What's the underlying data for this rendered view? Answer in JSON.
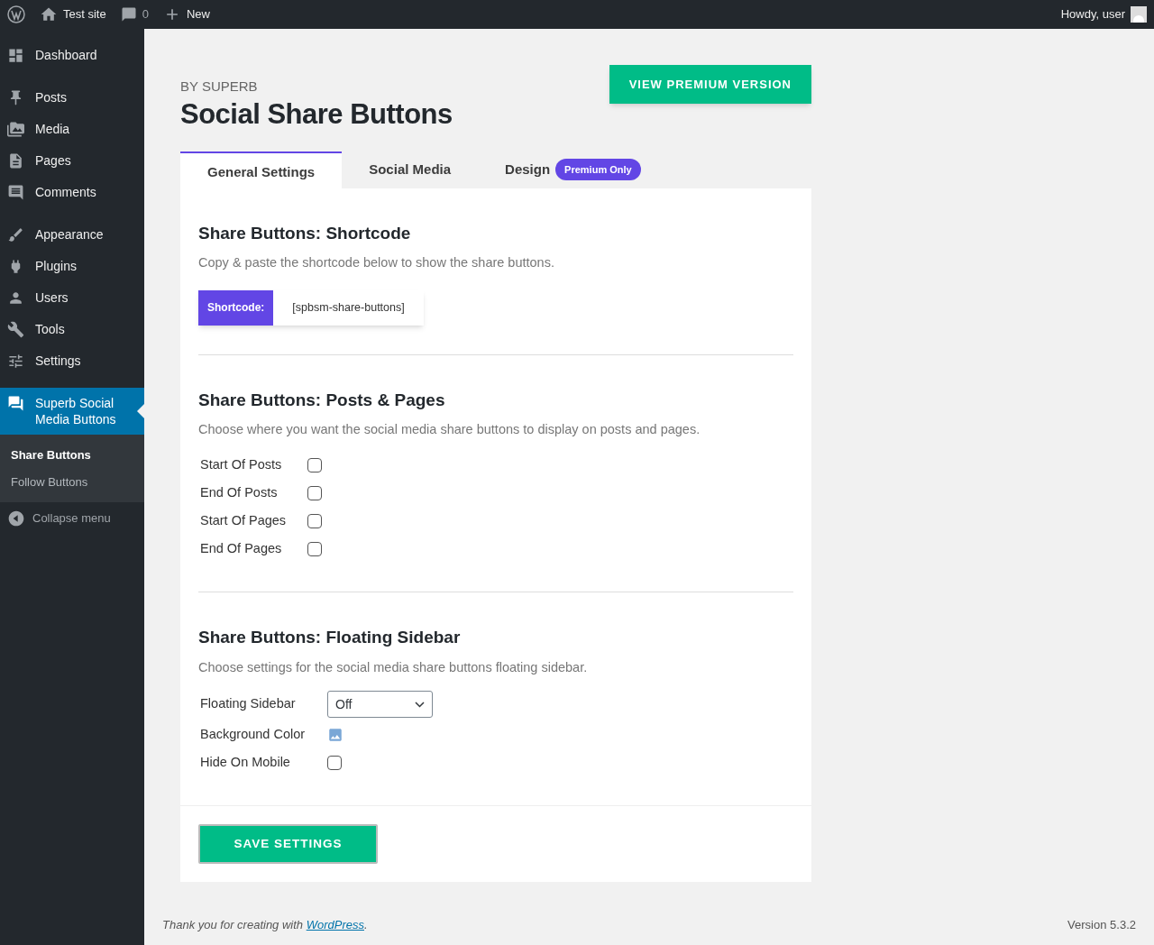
{
  "admin_bar": {
    "site": "Test site",
    "comments": "0",
    "new": "New",
    "greeting": "Howdy, user"
  },
  "sidebar": {
    "groups": [
      [
        {
          "label": "Dashboard",
          "selected": false
        }
      ],
      [
        {
          "label": "Posts",
          "selected": false
        },
        {
          "label": "Media",
          "selected": false
        },
        {
          "label": "Pages",
          "selected": false
        },
        {
          "label": "Comments",
          "selected": false
        }
      ],
      [
        {
          "label": "Appearance",
          "selected": false
        },
        {
          "label": "Plugins",
          "selected": false
        },
        {
          "label": "Users",
          "selected": false
        },
        {
          "label": "Tools",
          "selected": false
        },
        {
          "label": "Settings",
          "selected": false
        }
      ],
      [
        {
          "label": "Superb Social Media Buttons",
          "selected": true
        }
      ]
    ],
    "submenu": [
      {
        "label": "Share Buttons",
        "selected": true
      },
      {
        "label": "Follow Buttons",
        "selected": false
      }
    ],
    "collapse": "Collapse menu"
  },
  "header": {
    "byline": "BY SUPERB",
    "title": "Social Share Buttons",
    "premium_button": "VIEW PREMIUM VERSION"
  },
  "tabs": [
    {
      "label": "General Settings",
      "selected": true
    },
    {
      "label": "Social Media",
      "selected": false
    },
    {
      "label": "Design",
      "selected": false,
      "badge": "Premium Only"
    }
  ],
  "sections": [
    {
      "title": "Share Buttons: Shortcode",
      "description": "Copy & paste the shortcode below to show the share buttons.",
      "shortcode": {
        "label": "Shortcode:",
        "value": "[spbsm-share-buttons]"
      }
    },
    {
      "title": "Share Buttons: Posts & Pages",
      "description": "Choose where you want the social media share buttons to display on posts and pages.",
      "options": [
        {
          "kind": "checkbox",
          "label": "Start Of Posts",
          "checked": false
        },
        {
          "kind": "checkbox",
          "label": "End Of Posts",
          "checked": false
        },
        {
          "kind": "checkbox",
          "label": "Start Of Pages",
          "checked": false
        },
        {
          "kind": "checkbox",
          "label": "End Of Pages",
          "checked": false
        }
      ]
    },
    {
      "title": "Share Buttons: Floating Sidebar",
      "description": "Choose settings for the social media share buttons floating sidebar.",
      "options": [
        {
          "kind": "select",
          "label": "Floating Sidebar",
          "value": "Off"
        },
        {
          "kind": "image",
          "label": "Background Color"
        },
        {
          "kind": "checkbox",
          "label": "Hide On Mobile",
          "checked": false
        }
      ]
    }
  ],
  "save_button": "SAVE SETTINGS",
  "footer": {
    "text": "Thank you for creating with",
    "link": "WordPress",
    "after": ".",
    "version": "Version 5.3.2"
  }
}
